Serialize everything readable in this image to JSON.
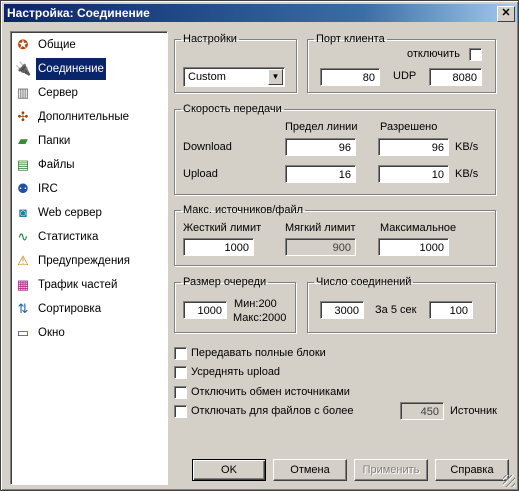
{
  "window": {
    "title": "Настройка: Соединение",
    "close_label": "✕"
  },
  "sidebar": {
    "items": [
      {
        "label": "Общие",
        "icon": "✪"
      },
      {
        "label": "Соединение",
        "icon": "🔌"
      },
      {
        "label": "Сервер",
        "icon": "▥"
      },
      {
        "label": "Дополнительные",
        "icon": "✣"
      },
      {
        "label": "Папки",
        "icon": "▰"
      },
      {
        "label": "Файлы",
        "icon": "▤"
      },
      {
        "label": "IRC",
        "icon": "⚉"
      },
      {
        "label": "Web сервер",
        "icon": "◙"
      },
      {
        "label": "Статистика",
        "icon": "∿"
      },
      {
        "label": "Предупреждения",
        "icon": "⚠"
      },
      {
        "label": "Трафик частей",
        "icon": "▦"
      },
      {
        "label": "Сортировка",
        "icon": "⇅"
      },
      {
        "label": "Окно",
        "icon": "▭"
      }
    ],
    "selected_index": 1
  },
  "settings": {
    "legend": "Настройки",
    "preset_value": "Custom"
  },
  "client_port": {
    "legend": "Порт клиента",
    "disable_label": "отключить",
    "tcp_value": "80",
    "udp_label": "UDP",
    "udp_value": "8080"
  },
  "speed": {
    "legend": "Скорость передачи",
    "col_limit": "Предел линии",
    "col_allowed": "Разрешено",
    "download_label": "Download",
    "download_limit": "96",
    "download_allowed": "96",
    "upload_label": "Upload",
    "upload_limit": "16",
    "upload_allowed": "10",
    "unit": "KB/s"
  },
  "sources": {
    "legend": "Макс. источников/файл",
    "hard_label": "Жесткий лимит",
    "hard_value": "1000",
    "soft_label": "Мягкий лимит",
    "soft_value": "900",
    "max_label": "Максимальное",
    "max_value": "1000"
  },
  "queue": {
    "legend": "Размер очереди",
    "value": "1000",
    "min_text": "Мин:200",
    "max_text": "Макс:2000"
  },
  "connections": {
    "legend": "Число соединений",
    "value": "3000",
    "per_label": "За 5 сек",
    "per_value": "100"
  },
  "options": {
    "full_blocks": "Передавать полные блоки",
    "average_upload": "Усреднять upload",
    "disable_source_exchange": "Отключить обмен источниками",
    "disable_for_files": "Отключать для файлов с более",
    "files_threshold": "450",
    "files_threshold_unit": "Источник"
  },
  "buttons": {
    "ok": "OK",
    "cancel": "Отмена",
    "apply": "Применить",
    "help": "Справка"
  }
}
